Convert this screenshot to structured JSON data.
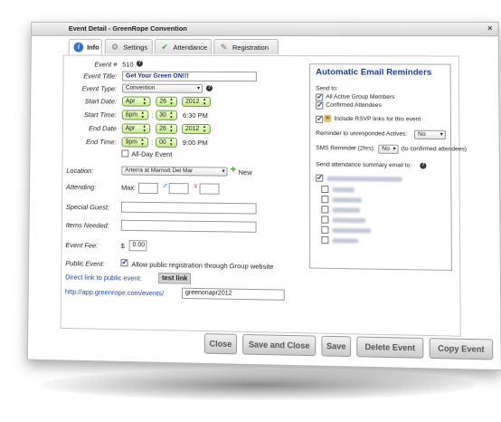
{
  "window": {
    "title": "Event Detail - GreenRope Convention",
    "close_glyph": "×"
  },
  "tabs": [
    {
      "label": "Info",
      "icon": "info-icon"
    },
    {
      "label": "Settings",
      "icon": "gear-icon"
    },
    {
      "label": "Attendance",
      "icon": "attendance-icon"
    },
    {
      "label": "Registration",
      "icon": "registration-icon"
    }
  ],
  "form": {
    "event_num_label": "Event #",
    "event_num": "510",
    "title_label": "Event Title:",
    "title_value": "Get Your Green ON!!!",
    "type_label": "Event Type:",
    "type_value": "Convention",
    "start_date_label": "Start Date:",
    "start_month": "Apr",
    "start_day": "26",
    "start_year": "2012",
    "start_time_label": "Start Time:",
    "start_hour": "6pm",
    "start_min": "30",
    "start_time_text": "6:30 PM",
    "end_date_label": "End Date",
    "end_month": "Apr",
    "end_day": "26",
    "end_year": "2012",
    "end_time_label": "End Time:",
    "end_hour": "9pm",
    "end_min": "00",
    "end_time_text": "9:00 PM",
    "all_day_label": "All-Day Event",
    "location_label": "Location:",
    "location_value": "Arterra at Marriott Del Mar",
    "new_label": "New",
    "attending_label": "Attending:",
    "max_label": "Max:",
    "special_guest_label": "Special Guest:",
    "items_needed_label": "Items Needed:",
    "fee_label": "Event Fee:",
    "fee_currency": "$",
    "fee_value": "0.00",
    "public_label": "Public Event:",
    "public_text": "Allow public registration through Group website",
    "direct_link_label": "Direct link to public event:",
    "test_link": "test link",
    "url_prefix": "http://app.greenrope.com/events/",
    "url_slug": "greenonapr2012"
  },
  "reminders": {
    "title": "Automatic Email Reminders",
    "send_to": "Send to:",
    "opt_active": "All Active Group Members",
    "opt_confirmed": "Confirmed Attendees",
    "rsvp_text": "Include RSVP links for this event",
    "unresponded_label": "Reminder to unresponded Actives:",
    "unresponded_value": "No",
    "sms_label": "SMS Reminder (2hrs):",
    "sms_value": "No",
    "sms_note": "(to confirmed attendees)",
    "summary_label": "Send attendance summary email to:"
  },
  "buttons": {
    "close": "Close",
    "save_close": "Save and Close",
    "save": "Save",
    "delete": "Delete Event",
    "copy": "Copy Event"
  }
}
